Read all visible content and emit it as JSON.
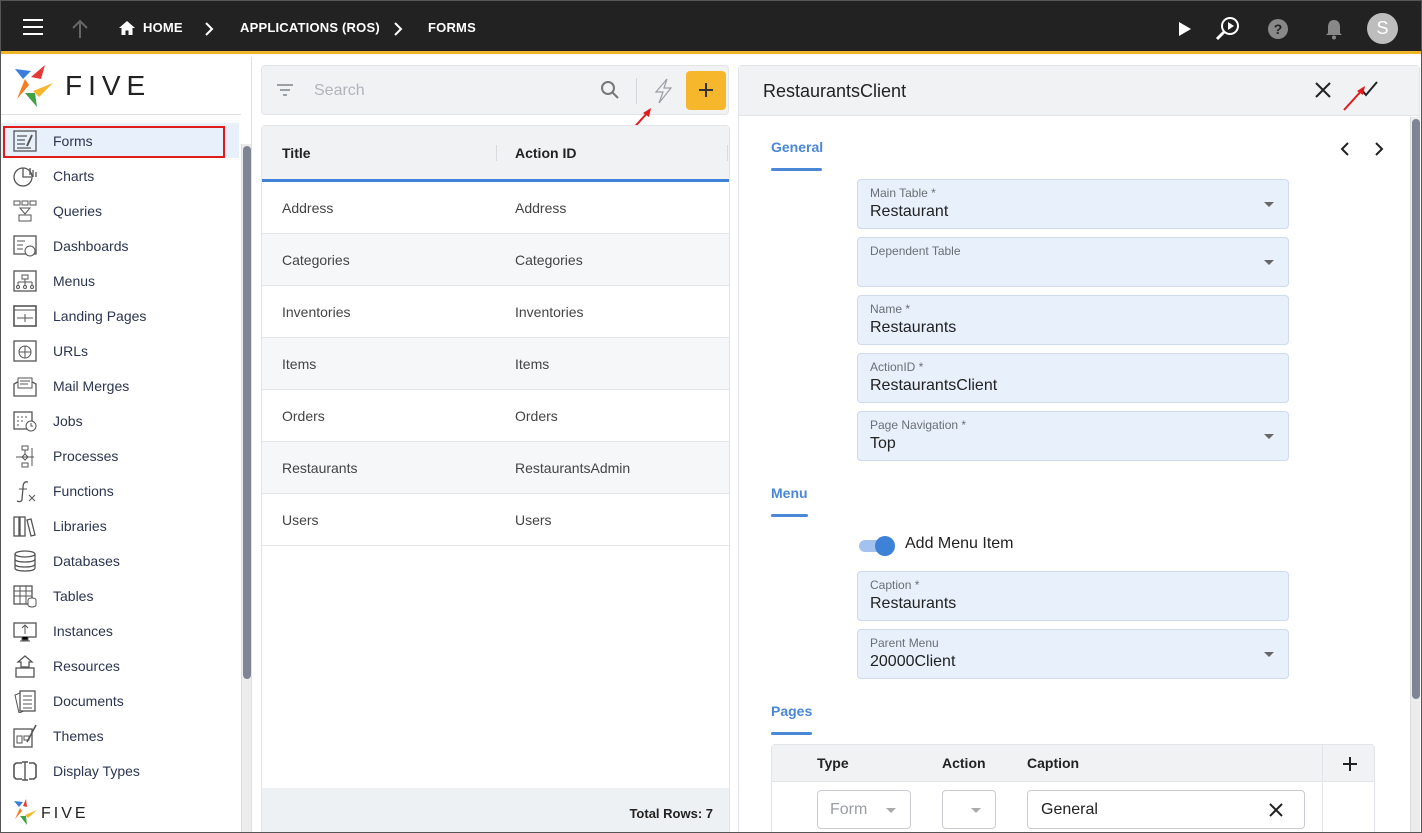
{
  "topbar": {
    "breadcrumb": [
      "HOME",
      "APPLICATIONS (ROS)",
      "FORMS"
    ],
    "avatar_initial": "S",
    "accent_color": "#f0b429"
  },
  "sidebar": {
    "logo_text": "FIVE",
    "items": [
      {
        "label": "Forms",
        "icon": "forms-icon",
        "active": true
      },
      {
        "label": "Charts",
        "icon": "charts-icon"
      },
      {
        "label": "Queries",
        "icon": "queries-icon"
      },
      {
        "label": "Dashboards",
        "icon": "dashboards-icon"
      },
      {
        "label": "Menus",
        "icon": "menus-icon"
      },
      {
        "label": "Landing Pages",
        "icon": "landing-pages-icon"
      },
      {
        "label": "URLs",
        "icon": "urls-icon"
      },
      {
        "label": "Mail Merges",
        "icon": "mail-merges-icon"
      },
      {
        "label": "Jobs",
        "icon": "jobs-icon"
      },
      {
        "label": "Processes",
        "icon": "processes-icon"
      },
      {
        "label": "Functions",
        "icon": "functions-icon"
      },
      {
        "label": "Libraries",
        "icon": "libraries-icon"
      },
      {
        "label": "Databases",
        "icon": "databases-icon"
      },
      {
        "label": "Tables",
        "icon": "tables-icon"
      },
      {
        "label": "Instances",
        "icon": "instances-icon"
      },
      {
        "label": "Resources",
        "icon": "resources-icon"
      },
      {
        "label": "Documents",
        "icon": "documents-icon"
      },
      {
        "label": "Themes",
        "icon": "themes-icon"
      },
      {
        "label": "Display Types",
        "icon": "display-types-icon"
      }
    ]
  },
  "list": {
    "search_placeholder": "Search",
    "columns": [
      "Title",
      "Action ID"
    ],
    "rows": [
      {
        "title": "Address",
        "action_id": "Address"
      },
      {
        "title": "Categories",
        "action_id": "Categories"
      },
      {
        "title": "Inventories",
        "action_id": "Inventories"
      },
      {
        "title": "Items",
        "action_id": "Items"
      },
      {
        "title": "Orders",
        "action_id": "Orders"
      },
      {
        "title": "Restaurants",
        "action_id": "RestaurantsAdmin"
      },
      {
        "title": "Users",
        "action_id": "Users"
      }
    ],
    "total_rows_label": "Total Rows: 7"
  },
  "form": {
    "title": "RestaurantsClient",
    "sections": {
      "general": "General",
      "menu": "Menu",
      "pages": "Pages"
    },
    "fields": {
      "main_table": {
        "label": "Main Table *",
        "value": "Restaurant"
      },
      "dependent_table": {
        "label": "Dependent Table",
        "value": ""
      },
      "name": {
        "label": "Name *",
        "value": "Restaurants"
      },
      "action_id": {
        "label": "ActionID *",
        "value": "RestaurantsClient"
      },
      "page_navigation": {
        "label": "Page Navigation *",
        "value": "Top"
      },
      "caption": {
        "label": "Caption *",
        "value": "Restaurants"
      },
      "parent_menu": {
        "label": "Parent Menu",
        "value": "20000Client"
      }
    },
    "add_menu_item": {
      "label": "Add Menu Item",
      "checked": true
    },
    "pages_table": {
      "columns": [
        "Type",
        "Action",
        "Caption"
      ],
      "rows": [
        {
          "type": "Form",
          "action": "",
          "caption": "General"
        }
      ]
    }
  }
}
